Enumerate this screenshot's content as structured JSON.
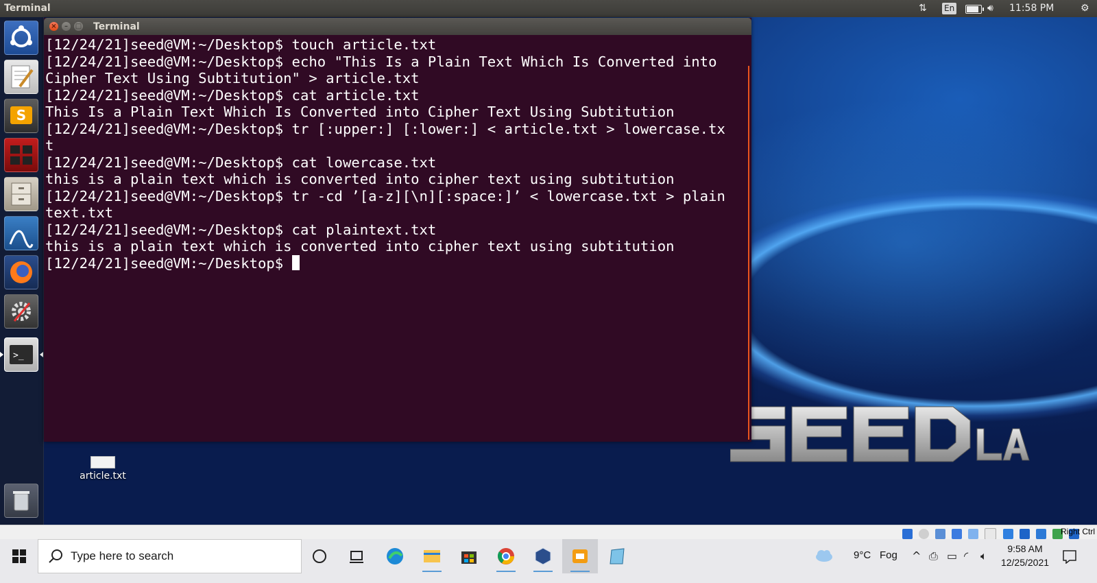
{
  "top_panel": {
    "app_title": "Terminal",
    "keyboard_layout": "En",
    "time": "11:58 PM",
    "icons": [
      "network-icon",
      "keyboard-layout-indicator",
      "battery-icon",
      "volume-icon",
      "gear-icon"
    ]
  },
  "launcher": {
    "items": [
      {
        "name": "ubuntu-dash",
        "icon": "ubuntu-logo-icon"
      },
      {
        "name": "text-editor",
        "icon": "text-editor-icon"
      },
      {
        "name": "sublime-text",
        "icon": "sublime-icon"
      },
      {
        "name": "terminator",
        "icon": "terminator-icon"
      },
      {
        "name": "files",
        "icon": "file-cabinet-icon"
      },
      {
        "name": "wireshark",
        "icon": "wireshark-icon"
      },
      {
        "name": "firefox",
        "icon": "firefox-icon"
      },
      {
        "name": "system-settings",
        "icon": "settings-icon"
      },
      {
        "name": "terminal",
        "icon": "terminal-icon"
      },
      {
        "name": "trash",
        "icon": "trash-icon"
      }
    ]
  },
  "terminal": {
    "title": "Terminal",
    "lines": [
      "[12/24/21]seed@VM:~/Desktop$ touch article.txt",
      "[12/24/21]seed@VM:~/Desktop$ echo \"This Is a Plain Text Which Is Converted into",
      "Cipher Text Using Subtitution\" > article.txt",
      "[12/24/21]seed@VM:~/Desktop$ cat article.txt",
      "This Is a Plain Text Which Is Converted into Cipher Text Using Subtitution",
      "[12/24/21]seed@VM:~/Desktop$ tr [:upper:] [:lower:] < article.txt > lowercase.tx",
      "t",
      "[12/24/21]seed@VM:~/Desktop$ cat lowercase.txt",
      "this is a plain text which is converted into cipher text using subtitution",
      "[12/24/21]seed@VM:~/Desktop$ tr -cd ’[a-z][\\n][:space:]’ < lowercase.txt > plain",
      "text.txt",
      "[12/24/21]seed@VM:~/Desktop$ cat plaintext.txt",
      "this is a plain text which is converted into cipher text using subtitution"
    ],
    "prompt": "[12/24/21]seed@VM:~/Desktop$ "
  },
  "desktop": {
    "file_label": "article.txt",
    "brand": "SEEDLABS"
  },
  "vbox_status": {
    "host_key": "Right Ctrl"
  },
  "taskbar": {
    "search_placeholder": "Type here to search",
    "weather_temp": "9°C",
    "weather_condition": "Fog",
    "clock_time": "9:58 AM",
    "clock_date": "12/25/2021",
    "pinned": [
      "task-view-icon",
      "widgets-icon",
      "edge-icon",
      "file-explorer-icon",
      "microsoft-store-icon",
      "chrome-icon",
      "virtualbox-icon",
      "seed-vm-icon",
      "notepad-icon"
    ]
  }
}
